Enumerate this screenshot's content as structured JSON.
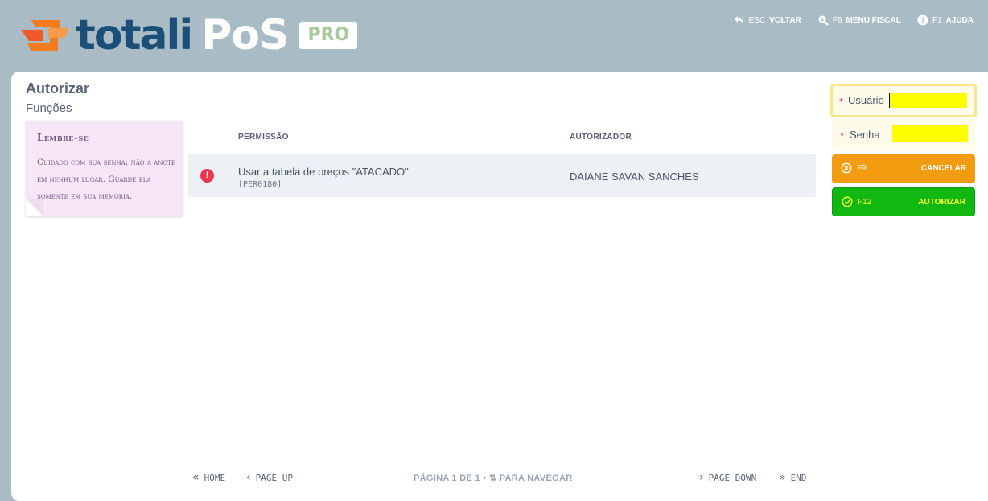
{
  "header": {
    "logo_word": "totali",
    "logo_pos": "PoS",
    "logo_badge": "PRO",
    "actions": [
      {
        "key": "ESC",
        "label": "VOLTAR",
        "icon": "undo-icon"
      },
      {
        "key": "F6",
        "label": "MENU FISCAL",
        "icon": "search-dollar-icon"
      },
      {
        "key": "F1",
        "label": "AJUDA",
        "icon": "help-icon"
      }
    ]
  },
  "page": {
    "title": "Autorizar",
    "subtitle": "Funções"
  },
  "note": {
    "title": "Lembre-se",
    "text": "Cuidado com sua senha: não a anote em nenhum lugar. Guarde ela somente em sua memória."
  },
  "table": {
    "columns": [
      "PERMISSÃO",
      "AUTORIZADOR"
    ],
    "rows": [
      {
        "status_icon": "alert-icon",
        "permission": "Usar a tabela de preços \"ATACADO\".",
        "code": "[PER0180]",
        "authorizer": "DAIANE SAVAN SANCHES"
      }
    ]
  },
  "form": {
    "user_label": "Usuário",
    "user_value": "",
    "password_label": "Senha",
    "password_value": ""
  },
  "buttons": {
    "cancel": {
      "key": "F9",
      "label": "CANCELAR",
      "color": "#f39c12"
    },
    "authorize": {
      "key": "F12",
      "label": "AUTORIZAR",
      "color": "#12b812"
    }
  },
  "footer": {
    "home": "HOME",
    "page_up": "PAGE UP",
    "pagination": "PÁGINA 1 DE 1 • ⇅ PARA NAVEGAR",
    "page_down": "PAGE DOWN",
    "end": "END"
  }
}
